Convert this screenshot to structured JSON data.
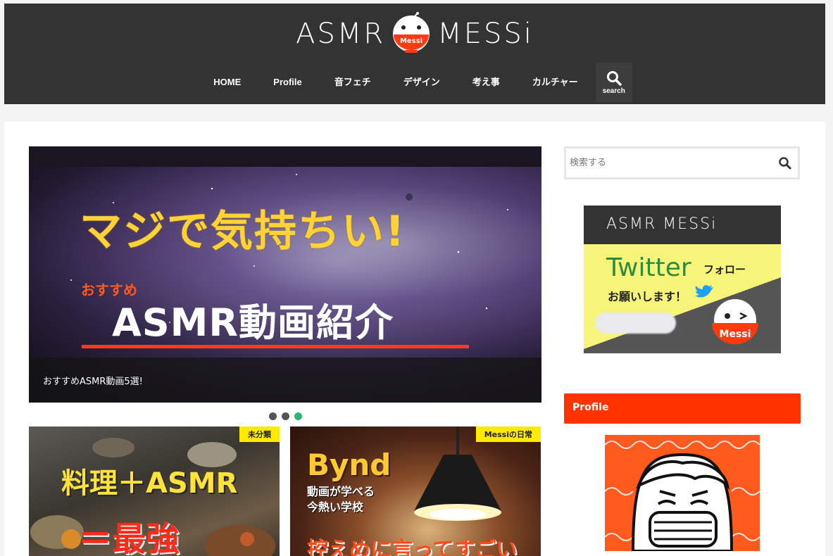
{
  "site": {
    "logo_left": "ASMR",
    "logo_right": "MESSi",
    "logo_bowl_label": "Messi"
  },
  "nav": {
    "items": [
      {
        "label": "HOME"
      },
      {
        "label": "Profile"
      },
      {
        "label": "音フェチ"
      },
      {
        "label": "デザイン"
      },
      {
        "label": "考え事"
      },
      {
        "label": "カルチャー"
      }
    ],
    "search_label": "search"
  },
  "slider": {
    "image_title": "マジで気持ちい!",
    "image_reco": "おすすめ",
    "image_main": "ASMR動画紹介",
    "caption": "おすすめASMR動画5選!",
    "dots": [
      {
        "active": false
      },
      {
        "active": false
      },
      {
        "active": true
      }
    ]
  },
  "thumbs": [
    {
      "category": "未分類",
      "line1": "料理＋ASMR",
      "line2": "＝最強"
    },
    {
      "category": "Messiの日常",
      "line1": "Bynd",
      "line2a": "動画が学べる",
      "line2b": "今熱い学校",
      "line3": "控えめに言ってすごい"
    }
  ],
  "sidebar": {
    "search_placeholder": "検索する",
    "banner": {
      "top": "ASMR MESSi",
      "twitter": "Twitter",
      "follow": "フォロー",
      "ask": "お願いします！",
      "bowl": "Messi"
    },
    "profile_title": "Profile"
  },
  "colors": {
    "header_bg": "#333333",
    "accent_orange": "#ff3300",
    "active_dot": "#2bb673",
    "badge_yellow": "#ffea00"
  }
}
